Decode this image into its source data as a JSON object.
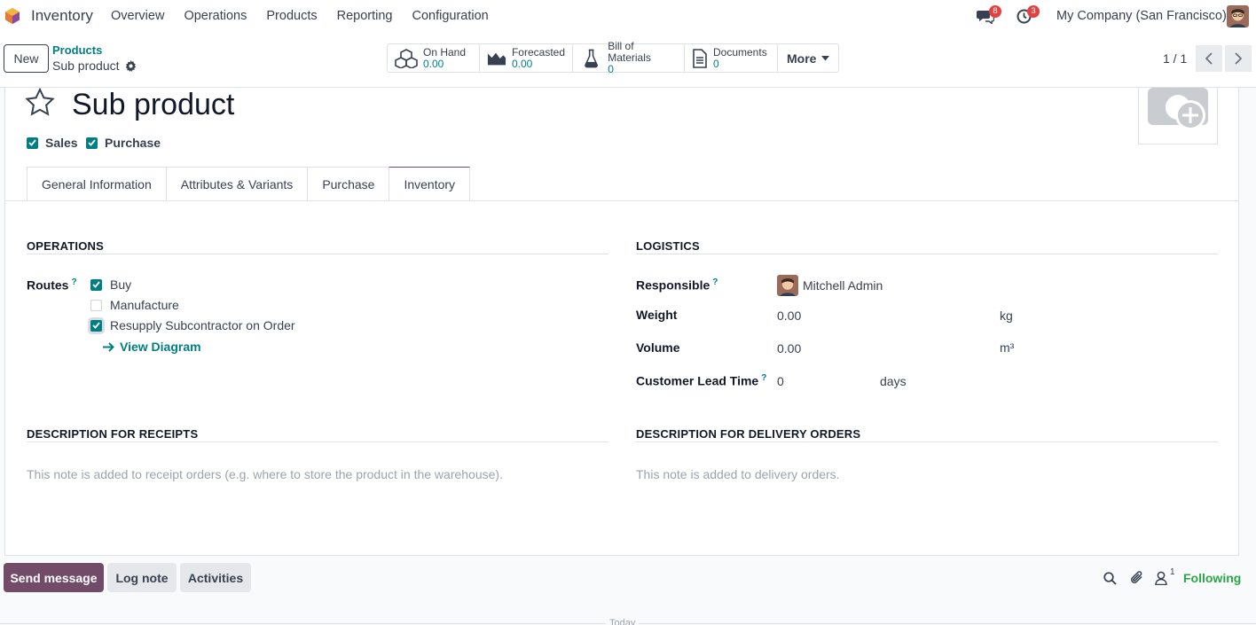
{
  "app": {
    "title": "Inventory"
  },
  "menu": [
    "Overview",
    "Operations",
    "Products",
    "Reporting",
    "Configuration"
  ],
  "nav": {
    "messages_count": "8",
    "activities_count": "3",
    "company": "My Company (San Francisco)"
  },
  "control": {
    "new_label": "New",
    "breadcrumb_parent": "Products",
    "breadcrumb_current": "Sub product",
    "smart_buttons": [
      {
        "label": "On Hand",
        "value": "0.00"
      },
      {
        "label": "Forecasted",
        "value": "0.00"
      },
      {
        "label": "Bill of Materials",
        "value": "0"
      },
      {
        "label": "Documents",
        "value": "0"
      }
    ],
    "more_label": "More",
    "pager": "1 / 1"
  },
  "product": {
    "name": "Sub product",
    "sales_label": "Sales",
    "purchase_label": "Purchase"
  },
  "tabs": [
    "General Information",
    "Attributes & Variants",
    "Purchase",
    "Inventory"
  ],
  "operations": {
    "title": "OPERATIONS",
    "routes_label": "Routes",
    "help": "?",
    "routes": [
      {
        "label": "Buy",
        "checked": true
      },
      {
        "label": "Manufacture",
        "checked": false
      },
      {
        "label": "Resupply Subcontractor on Order",
        "checked": true
      }
    ],
    "view_diagram": "View Diagram"
  },
  "logistics": {
    "title": "LOGISTICS",
    "responsible_label": "Responsible",
    "responsible_value": "Mitchell Admin",
    "weight_label": "Weight",
    "weight_value": "0.00",
    "weight_unit": "kg",
    "volume_label": "Volume",
    "volume_value": "0.00",
    "volume_unit": "m³",
    "lead_label": "Customer Lead Time",
    "lead_value": "0",
    "lead_unit": "days"
  },
  "receipts": {
    "title": "DESCRIPTION FOR RECEIPTS",
    "placeholder": "This note is added to receipt orders (e.g. where to store the product in the warehouse)."
  },
  "delivery": {
    "title": "DESCRIPTION FOR DELIVERY ORDERS",
    "placeholder": "This note is added to delivery orders."
  },
  "chatter": {
    "send_message": "Send message",
    "log_note": "Log note",
    "activities": "Activities",
    "followers_count": "1",
    "following": "Following",
    "today": "Today"
  },
  "colors": {
    "brand": "#714b67",
    "accent": "#017e84"
  }
}
